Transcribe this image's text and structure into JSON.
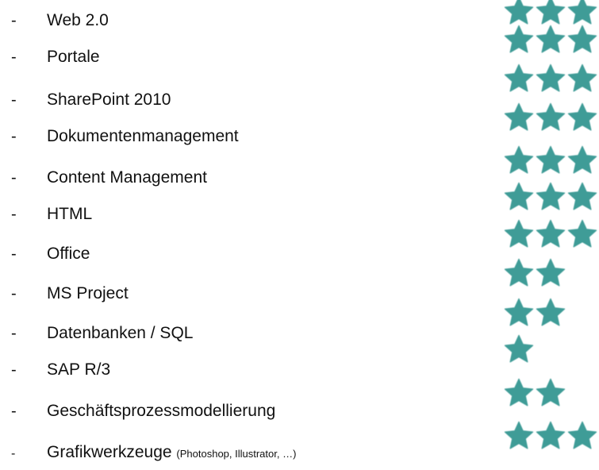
{
  "skills": [
    {
      "label": "Web 2.0",
      "note": "",
      "stars": 3
    },
    {
      "label": "Portale",
      "note": "",
      "stars": 3
    },
    {
      "label": "SharePoint 2010",
      "note": "",
      "stars": 3
    },
    {
      "label": "Dokumentenmanagement",
      "note": "",
      "stars": 3
    },
    {
      "label": "Content Management",
      "note": "",
      "stars": 3
    },
    {
      "label": "HTML",
      "note": "",
      "stars": 3
    },
    {
      "label": "Office",
      "note": "",
      "stars": 3
    },
    {
      "label": "MS Project",
      "note": "",
      "stars": 2
    },
    {
      "label": "Datenbanken / SQL",
      "note": "",
      "stars": 2
    },
    {
      "label": "SAP R/3",
      "note": "",
      "stars": 1
    },
    {
      "label": "Geschäftsprozessmodellierung",
      "note": "",
      "stars": 2
    },
    {
      "label": "Grafikwerkzeuge",
      "note": "(Photoshop, Illustrator, …)",
      "stars": 3
    }
  ],
  "bullet": "-",
  "star_icon": "star-icon",
  "colors": {
    "star": "#3f9c97",
    "text": "#111111",
    "background": "#ffffff"
  }
}
